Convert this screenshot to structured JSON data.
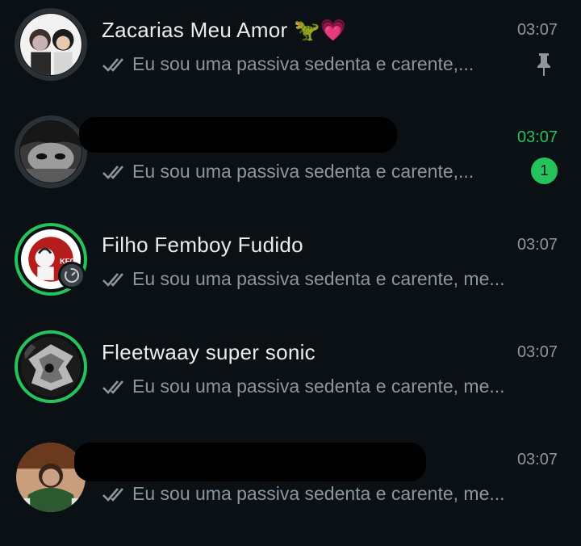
{
  "chats": [
    {
      "name": "Zacarias Meu Amor 🦖💗",
      "time": "03:07",
      "preview": "Eu sou uma passiva sedenta e carente,...",
      "pinned": true,
      "unread_count": "",
      "avatar_icon": "couple-photo"
    },
    {
      "name": "",
      "time": "03:07",
      "preview": "Eu sou uma passiva sedenta e carente,...",
      "pinned": false,
      "unread_count": "1",
      "avatar_icon": "monochrome-photo"
    },
    {
      "name": "Filho Femboy Fudido",
      "time": "03:07",
      "preview": "Eu sou uma passiva sedenta e carente, me...",
      "pinned": false,
      "unread_count": "",
      "avatar_icon": "kfc-logo",
      "avatar_text": "KFC"
    },
    {
      "name": "Fleetwaay super sonic",
      "time": "03:07",
      "preview": "Eu sou uma passiva sedenta e carente, me...",
      "pinned": false,
      "unread_count": "",
      "avatar_icon": "silver-sonic-photo"
    },
    {
      "name": "",
      "time": "03:07",
      "preview": "Eu sou uma passiva sedenta e carente, me...",
      "pinned": false,
      "unread_count": "",
      "avatar_icon": "crowd-photo"
    }
  ],
  "colors": {
    "background": "#0b1014",
    "primary_text": "#e9edef",
    "secondary_text": "#8d969b",
    "accent_green": "#25c35b"
  }
}
